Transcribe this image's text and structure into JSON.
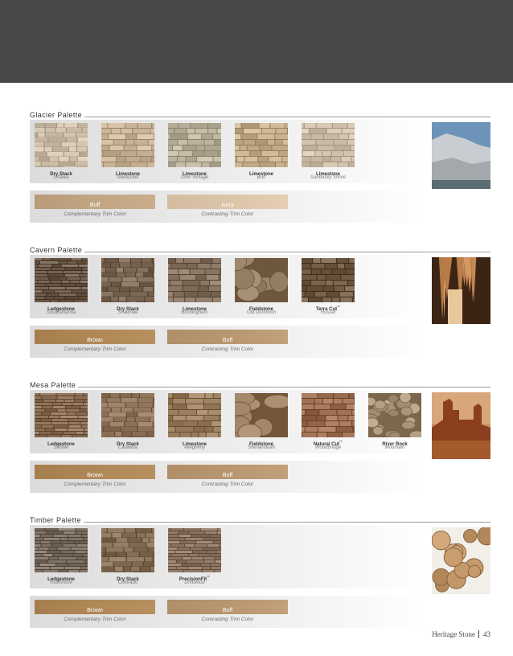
{
  "footer": {
    "brand": "Heritage Stone",
    "page_number": "43"
  },
  "palettes": [
    {
      "title": "Glacier Palette",
      "photo": "glacier-mountain",
      "stones": [
        {
          "name": "Dry Stack",
          "sub": "Ottawa",
          "tm": "",
          "texture": "drystack",
          "color": "#c9bba5"
        },
        {
          "name": "Limestone",
          "sub": "Nantucket",
          "tm": "",
          "texture": "brick",
          "color": "#c7b296"
        },
        {
          "name": "Limestone",
          "sub": "Ohio Vintage",
          "tm": "",
          "texture": "brick",
          "color": "#b9b09c"
        },
        {
          "name": "Limestone",
          "sub": "Buff",
          "tm": "",
          "texture": "brick",
          "color": "#c2ac8a"
        },
        {
          "name": "Limestone",
          "sub": "Sandusky Shore",
          "tm": "",
          "texture": "brick",
          "color": "#cfc1ab"
        }
      ],
      "trim": {
        "complementary": "Buff",
        "complementary_color": "#c2a582",
        "contrasting": "Ivory",
        "contrasting_color": "#dcc4a8",
        "complementary_caption": "Complementary Trim Color",
        "contrasting_caption": "Contrasting Trim Color"
      }
    },
    {
      "title": "Cavern Palette",
      "photo": "cavern",
      "stones": [
        {
          "name": "Ledgestone",
          "sub": "Susquehanna",
          "tm": "",
          "texture": "ledge",
          "color": "#6f5d4e"
        },
        {
          "name": "Dry Stack",
          "sub": "Shawnee",
          "tm": "",
          "texture": "drystack",
          "color": "#7a6654"
        },
        {
          "name": "Limestone",
          "sub": "Buckingham",
          "tm": "",
          "texture": "brick",
          "color": "#83705f"
        },
        {
          "name": "Fieldstone",
          "sub": "Old Dominion",
          "tm": "",
          "texture": "field",
          "color": "#9a846a"
        },
        {
          "name": "Terra Cut",
          "sub": "Russet",
          "tm": "™",
          "texture": "brick",
          "color": "#6e5a45"
        }
      ],
      "trim": {
        "complementary": "Brown",
        "complementary_color": "#b08858",
        "contrasting": "Buff",
        "contrasting_color": "#b89670",
        "complementary_caption": "Complementary Trim Color",
        "contrasting_caption": "Contrasting Trim Color"
      }
    },
    {
      "title": "Mesa Palette",
      "photo": "mesa",
      "stones": [
        {
          "name": "Ledgestone",
          "sub": "Santee",
          "tm": "",
          "texture": "ledge",
          "color": "#8a6e56"
        },
        {
          "name": "Dry Stack",
          "sub": "Catawba",
          "tm": "",
          "texture": "drystack",
          "color": "#8c7258"
        },
        {
          "name": "Limestone",
          "sub": "Allegheny",
          "tm": "",
          "texture": "brick",
          "color": "#967a5c"
        },
        {
          "name": "Fieldstone",
          "sub": "Shenandoah",
          "tm": "",
          "texture": "field",
          "color": "#a08468"
        },
        {
          "name": "Natural Cut",
          "sub": "Woodbridge",
          "tm": "™",
          "texture": "brick",
          "color": "#9a6c50"
        },
        {
          "name": "River Rock",
          "sub": "Mountain",
          "tm": "",
          "texture": "river",
          "color": "#a89478"
        }
      ],
      "trim": {
        "complementary": "Brown",
        "complementary_color": "#b08858",
        "contrasting": "Buff",
        "contrasting_color": "#b89670",
        "complementary_caption": "Complementary Trim Color",
        "contrasting_caption": "Contrasting Trim Color"
      }
    },
    {
      "title": "Timber Palette",
      "photo": "timber-logs",
      "stones": [
        {
          "name": "Ledgestone",
          "sub": "Rushmore",
          "tm": "",
          "texture": "ledge",
          "color": "#7b6e62"
        },
        {
          "name": "Dry Stack",
          "sub": "Colorado",
          "tm": "",
          "texture": "drystack",
          "color": "#826b55"
        },
        {
          "name": "PrecisionFit",
          "sub": "Driftwood",
          "tm": "™",
          "texture": "ledge",
          "color": "#8e7865"
        }
      ],
      "trim": {
        "complementary": "Brown",
        "complementary_color": "#b08858",
        "contrasting": "Buff",
        "contrasting_color": "#b89670",
        "complementary_caption": "Complementary Trim Color",
        "contrasting_caption": "Contrasting Trim Color"
      }
    }
  ]
}
